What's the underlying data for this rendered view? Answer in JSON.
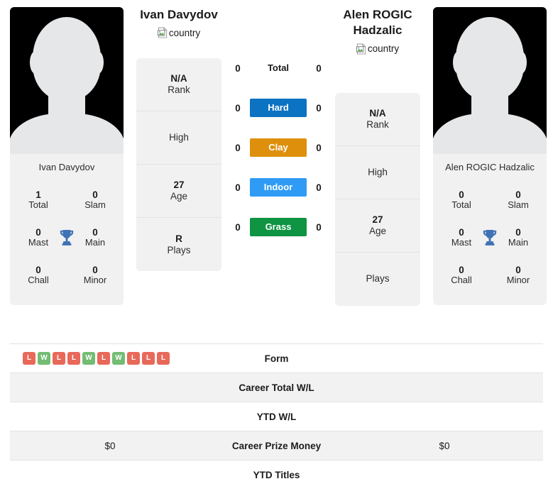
{
  "players": {
    "left": {
      "name": "Ivan Davydov",
      "photo_caption": "Ivan Davydov",
      "flag_label": "country",
      "mini_stats": [
        {
          "value": "1",
          "label": "Total"
        },
        {
          "value": "0",
          "label": "Slam"
        },
        {
          "value": "0",
          "label": "Mast"
        },
        {
          "value": "0",
          "label": "Main"
        },
        {
          "value": "0",
          "label": "Chall"
        },
        {
          "value": "0",
          "label": "Minor"
        }
      ],
      "info": [
        {
          "value": "N/A",
          "label": "Rank"
        },
        {
          "value": "",
          "label": "High"
        },
        {
          "value": "27",
          "label": "Age"
        },
        {
          "value": "R",
          "label": "Plays"
        }
      ]
    },
    "right": {
      "name": "Alen ROGIC Hadzalic",
      "photo_caption": "Alen ROGIC Hadzalic",
      "flag_label": "country",
      "mini_stats": [
        {
          "value": "0",
          "label": "Total"
        },
        {
          "value": "0",
          "label": "Slam"
        },
        {
          "value": "0",
          "label": "Mast"
        },
        {
          "value": "0",
          "label": "Main"
        },
        {
          "value": "0",
          "label": "Chall"
        },
        {
          "value": "0",
          "label": "Minor"
        }
      ],
      "info": [
        {
          "value": "N/A",
          "label": "Rank"
        },
        {
          "value": "",
          "label": "High"
        },
        {
          "value": "27",
          "label": "Age"
        },
        {
          "value": "",
          "label": "Plays"
        }
      ]
    }
  },
  "surfaces": [
    {
      "label": "Total",
      "left": "0",
      "right": "0",
      "color": "transparent",
      "plain": true
    },
    {
      "label": "Hard",
      "left": "0",
      "right": "0",
      "color": "#0c73c2",
      "plain": false
    },
    {
      "label": "Clay",
      "left": "0",
      "right": "0",
      "color": "#de900c",
      "plain": false
    },
    {
      "label": "Indoor",
      "left": "0",
      "right": "0",
      "color": "#2f9bf5",
      "plain": false
    },
    {
      "label": "Grass",
      "left": "0",
      "right": "0",
      "color": "#0e9442",
      "plain": false
    }
  ],
  "form": {
    "left_results": [
      "L",
      "W",
      "L",
      "L",
      "W",
      "L",
      "W",
      "L",
      "L",
      "L"
    ],
    "right_results": [],
    "win_color": "#72bc73",
    "loss_color": "#e8695a"
  },
  "table_rows": [
    {
      "left": "",
      "label": "Form",
      "right": "",
      "striped": false
    },
    {
      "left": "",
      "label": "Career Total W/L",
      "right": "",
      "striped": true
    },
    {
      "left": "",
      "label": "YTD W/L",
      "right": "",
      "striped": false
    },
    {
      "left": "$0",
      "label": "Career Prize Money",
      "right": "$0",
      "striped": true
    },
    {
      "left": "",
      "label": "YTD Titles",
      "right": "",
      "striped": false
    }
  ],
  "icons": {
    "trophy": "trophy-icon",
    "broken_image": "broken-image-icon"
  }
}
